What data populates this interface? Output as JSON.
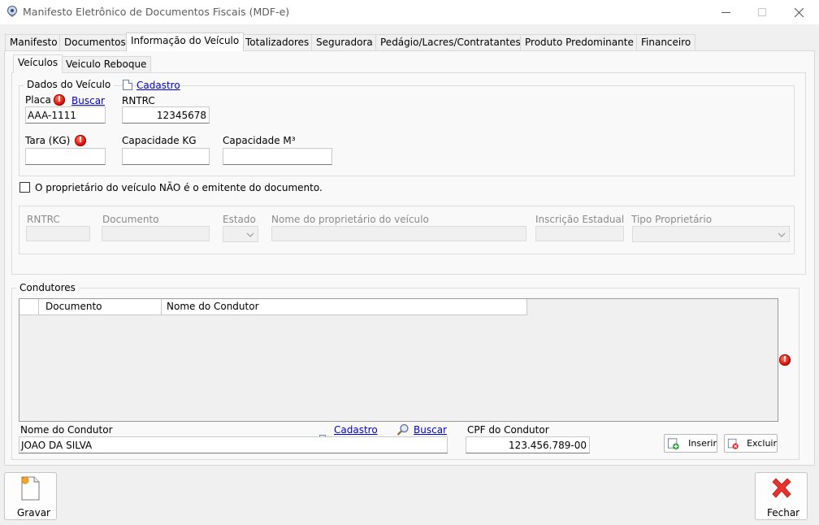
{
  "window": {
    "title": "Manifesto Eletrônico de Documentos Fiscais (MDF-e)"
  },
  "tabs": [
    {
      "label": "Manifesto"
    },
    {
      "label": "Documentos"
    },
    {
      "label": "Informação do Veículo"
    },
    {
      "label": "Totalizadores"
    },
    {
      "label": "Seguradora"
    },
    {
      "label": "Pedágio/Lacres/Contratantes"
    },
    {
      "label": "Produto Predominante"
    },
    {
      "label": "Financeiro"
    }
  ],
  "active_tab": "Informação do Veículo",
  "subtabs": [
    {
      "label": "Veículos"
    },
    {
      "label": "Veiculo Reboque"
    }
  ],
  "dados_veiculo": {
    "group_label": "Dados do Veículo",
    "cadastro_link": "Cadastro",
    "placa_label": "Placa",
    "buscar_link": "Buscar",
    "placa_value": "AAA-1111",
    "rntrc_label": "RNTRC",
    "rntrc_value": "12345678",
    "tara_label": "Tara (KG)",
    "tara_value": "",
    "capacidade_kg_label": "Capacidade KG",
    "capacidade_kg_value": "",
    "capacidade_m3_label": "Capacidade M³",
    "capacidade_m3_value": ""
  },
  "proprietario": {
    "checkbox_label": "O proprietário do veículo NÃO é o emitente do documento.",
    "checked": false,
    "rntrc_label": "RNTRC",
    "documento_label": "Documento",
    "estado_label": "Estado",
    "nome_label": "Nome do proprietário do veículo",
    "ie_label": "Inscrição Estadual",
    "tipo_label": "Tipo Proprietário"
  },
  "condutores": {
    "group_label": "Condutores",
    "columns": [
      "Documento",
      "Nome do Condutor"
    ],
    "rows": [],
    "nome_label": "Nome do Condutor",
    "cadastro_link": "Cadastro",
    "buscar_link": "Buscar",
    "nome_value": "JOAO DA SILVA",
    "cpf_label": "CPF do Condutor",
    "cpf_value": "123.456.789-00",
    "inserir_label": "Inserir",
    "excluir_label": "Excluir"
  },
  "footer": {
    "gravar_label": "Gravar",
    "fechar_label": "Fechar"
  },
  "colors": {
    "link": "#0000cc",
    "error": "#d40000",
    "close_red": "#e8322a"
  },
  "icons": [
    "app-icon",
    "minimize-icon",
    "maximize-icon",
    "close-icon",
    "document-icon",
    "error-icon",
    "search-icon",
    "add-icon",
    "delete-icon",
    "save-icon",
    "close-x-icon"
  ]
}
